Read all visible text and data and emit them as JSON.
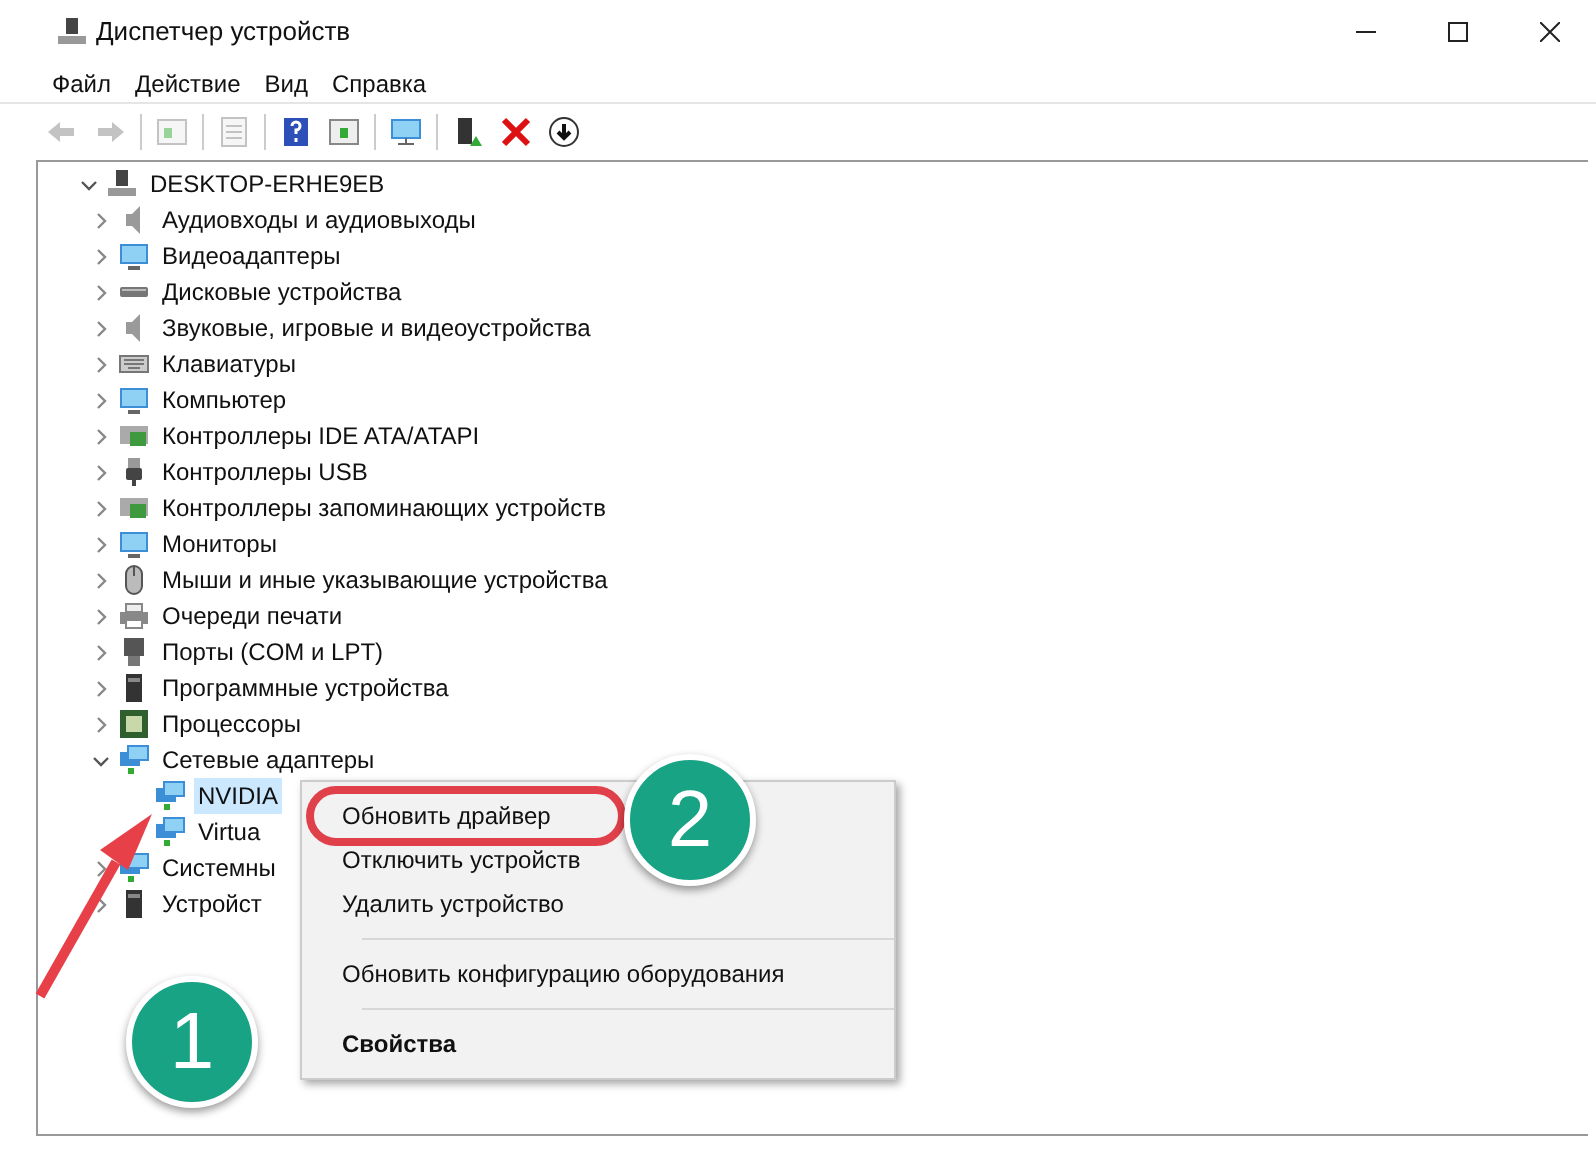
{
  "window": {
    "title": "Диспетчер устройств"
  },
  "menu": [
    "Файл",
    "Действие",
    "Вид",
    "Справка"
  ],
  "tree": {
    "label": "DESKTOP-ERHE9EB",
    "expanded": true,
    "children": [
      {
        "label": "Аудиовходы и аудиовыходы",
        "expanded": false
      },
      {
        "label": "Видеоадаптеры",
        "expanded": false
      },
      {
        "label": "Дисковые устройства",
        "expanded": false
      },
      {
        "label": "Звуковые, игровые и видеоустройства",
        "expanded": false
      },
      {
        "label": "Клавиатуры",
        "expanded": false
      },
      {
        "label": "Компьютер",
        "expanded": false
      },
      {
        "label": "Контроллеры IDE ATA/ATAPI",
        "expanded": false
      },
      {
        "label": "Контроллеры USB",
        "expanded": false
      },
      {
        "label": "Контроллеры запоминающих устройств",
        "expanded": false
      },
      {
        "label": "Мониторы",
        "expanded": false
      },
      {
        "label": "Мыши и иные указывающие устройства",
        "expanded": false
      },
      {
        "label": "Очереди печати",
        "expanded": false
      },
      {
        "label": "Порты (COM и LPT)",
        "expanded": false
      },
      {
        "label": "Программные устройства",
        "expanded": false
      },
      {
        "label": "Процессоры",
        "expanded": false
      },
      {
        "label": "Сетевые адаптеры",
        "expanded": true,
        "children": [
          {
            "label": "NVIDIA",
            "selected": true
          },
          {
            "label": "Virtua",
            "selected": false
          }
        ]
      },
      {
        "label": "Системны",
        "expanded": false
      },
      {
        "label": "Устройст",
        "expanded": false
      }
    ]
  },
  "context_menu": {
    "items": [
      {
        "kind": "item",
        "label": "Обновить драйвер",
        "default": false,
        "circled": true
      },
      {
        "kind": "item",
        "label": "Отключить устройств",
        "default": false,
        "circled": false
      },
      {
        "kind": "item",
        "label": "Удалить устройство",
        "default": false,
        "circled": false
      },
      {
        "kind": "separator"
      },
      {
        "kind": "item",
        "label": "Обновить конфигурацию оборудования",
        "default": false,
        "circled": false
      },
      {
        "kind": "separator"
      },
      {
        "kind": "item",
        "label": "Свойства",
        "default": true,
        "circled": false
      }
    ]
  },
  "annotations": [
    {
      "label": "2",
      "kind": "badge"
    },
    {
      "label": "1",
      "kind": "badge"
    }
  ]
}
